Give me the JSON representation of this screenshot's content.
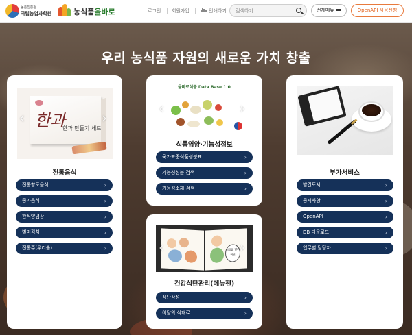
{
  "header": {
    "logo_org_small": "농촌진흥청",
    "logo_org": "국립농업과학원",
    "logo_site_prefix": "농식품",
    "logo_site_suffix": "올바로",
    "login": "로그인",
    "join": "회원가입",
    "print": "인쇄하기",
    "search_placeholder": "검색하기",
    "all_menu": "전체메뉴",
    "openapi_apply": "OpenAPI 사용신청"
  },
  "hero": {
    "title": "우리 농식품 자원의 새로운 가치 창출"
  },
  "cards": [
    {
      "title": "전통음식",
      "image_text": "한과 만들기 세트",
      "links": [
        "전통향토음식",
        "종가음식",
        "한식양념장",
        "별미김치",
        "전통주(우리술)"
      ]
    },
    {
      "title": "식품영양·기능성정보",
      "image_text": "올바로식품 Data Base 1.0",
      "links": [
        "국가표준식품성분표",
        "기능성성분 검색",
        "기능성소재 검색"
      ]
    },
    {
      "title": "건강식단관리(메뉴젠)",
      "image_text": "식단을 알려줘요",
      "links": [
        "식단작성",
        "이달의 식재료"
      ]
    },
    {
      "title": "부가서비스",
      "links": [
        "발간도서",
        "공지사항",
        "OpenAPI",
        "DB 다운로드",
        "업무별 담당자"
      ]
    }
  ],
  "icons": {
    "prev": "‹",
    "next": "›",
    "chevron": "›"
  },
  "colors": {
    "pill_bg": "#153159",
    "accent_orange": "#e2601b",
    "brand_green": "#2a7d2e"
  }
}
